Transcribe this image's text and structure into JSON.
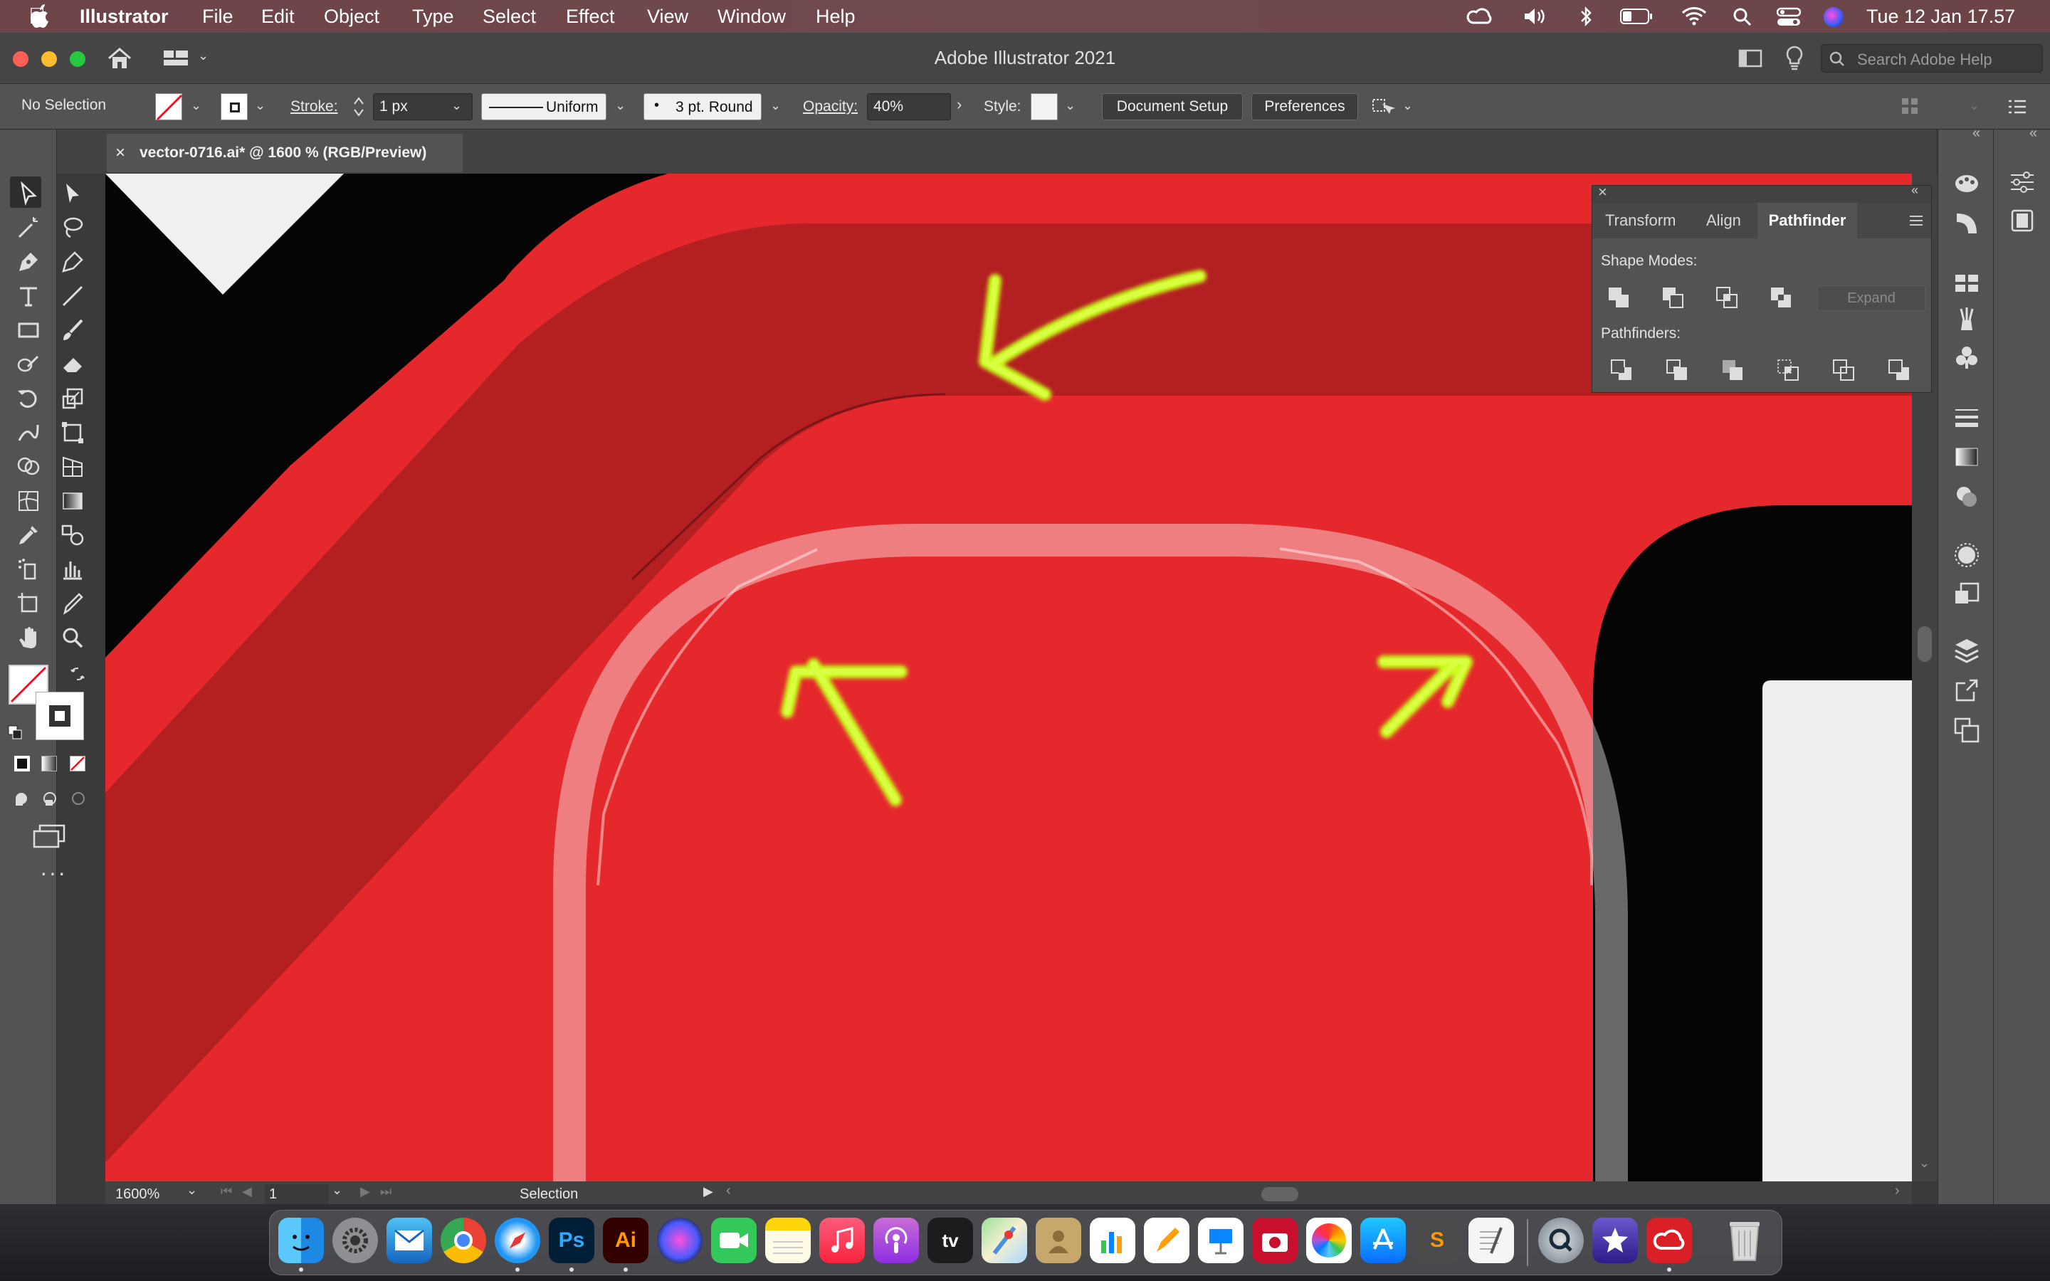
{
  "menubar": {
    "app_name": "Illustrator",
    "items": [
      "File",
      "Edit",
      "Object",
      "Type",
      "Select",
      "Effect",
      "View",
      "Window",
      "Help"
    ],
    "datetime": "Tue 12 Jan  17.57"
  },
  "titlebar": {
    "title": "Adobe Illustrator 2021",
    "search_placeholder": "Search Adobe Help"
  },
  "controlbar": {
    "selection_status": "No Selection",
    "stroke_label": "Stroke:",
    "stroke_weight": "1 px",
    "stroke_profile": "Uniform",
    "brush": "3 pt. Round",
    "opacity_label": "Opacity:",
    "opacity_value": "40%",
    "style_label": "Style:",
    "document_setup": "Document Setup",
    "preferences": "Preferences"
  },
  "document": {
    "tab_title": "vector-0716.ai* @ 1600 % (RGB/Preview)"
  },
  "pathfinder_panel": {
    "tabs": [
      "Transform",
      "Align",
      "Pathfinder"
    ],
    "active_tab": "Pathfinder",
    "shape_modes_label": "Shape Modes:",
    "expand_label": "Expand",
    "pathfinders_label": "Pathfinders:"
  },
  "statusbar": {
    "zoom": "1600%",
    "artboard": "1",
    "tool": "Selection"
  },
  "colors": {
    "canvas_red": "#e5282c",
    "dark_red": "#b41f22",
    "arrow": "#c9ff1a",
    "menubar": "#6d4448"
  },
  "dock": {
    "apps": [
      "Finder",
      "System Preferences",
      "Mail",
      "Chrome",
      "Safari",
      "Photoshop",
      "Illustrator",
      "Siri",
      "FaceTime",
      "Notes",
      "Music",
      "Podcasts",
      "TV",
      "Maps",
      "Contacts",
      "Numbers",
      "Pages",
      "Keynote",
      "Photo Booth",
      "Photos",
      "App Store",
      "Sublime Text",
      "TextEdit",
      "QuickTime",
      "iMovie",
      "Creative Cloud",
      "Trash"
    ],
    "ps_label": "Ps",
    "ai_label": "Ai",
    "tv_label": "tv",
    "st_label": "S"
  }
}
